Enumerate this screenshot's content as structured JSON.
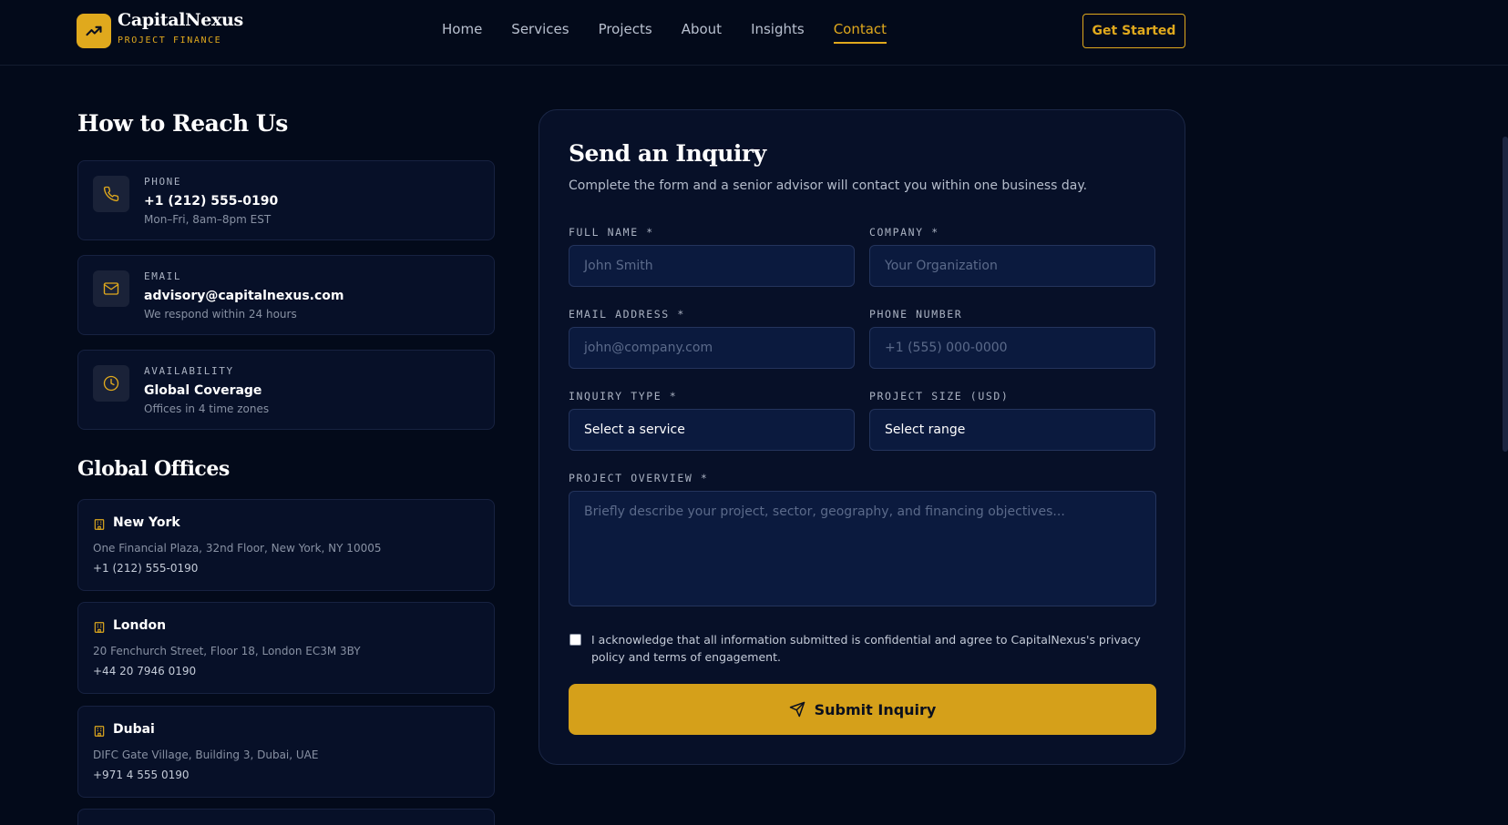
{
  "brand": {
    "name": "CapitalNexus",
    "tagline": "PROJECT FINANCE",
    "accent": "#e0a91d",
    "background": "#030a1a"
  },
  "nav": {
    "items": [
      "Home",
      "Services",
      "Projects",
      "About",
      "Insights",
      "Contact"
    ],
    "active": "Contact",
    "cta": "Get Started"
  },
  "reach": {
    "title": "How to Reach Us",
    "cards": [
      {
        "icon": "phone-icon",
        "label": "PHONE",
        "value": "+1 (212) 555-0190",
        "note": "Mon–Fri, 8am–8pm EST"
      },
      {
        "icon": "mail-icon",
        "label": "EMAIL",
        "value": "advisory@capitalnexus.com",
        "note": "We respond within 24 hours"
      },
      {
        "icon": "clock-icon",
        "label": "AVAILABILITY",
        "value": "Global Coverage",
        "note": "Offices in 4 time zones"
      }
    ]
  },
  "offices": {
    "title": "Global Offices",
    "list": [
      {
        "name": "New York",
        "address": "One Financial Plaza, 32nd Floor, New York, NY 10005",
        "phone": "+1 (212) 555-0190"
      },
      {
        "name": "London",
        "address": "20 Fenchurch Street, Floor 18, London EC3M 3BY",
        "phone": "+44 20 7946 0190"
      },
      {
        "name": "Dubai",
        "address": "DIFC Gate Village, Building 3, Dubai, UAE",
        "phone": "+971 4 555 0190"
      }
    ]
  },
  "form": {
    "title": "Send an Inquiry",
    "subtitle": "Complete the form and a senior advisor will contact you within one business day.",
    "full_name": {
      "label": "FULL NAME *",
      "placeholder": "John Smith"
    },
    "company": {
      "label": "COMPANY *",
      "placeholder": "Your Organization"
    },
    "email": {
      "label": "EMAIL ADDRESS *",
      "placeholder": "john@company.com"
    },
    "phone": {
      "label": "PHONE NUMBER",
      "placeholder": "+1 (555) 000-0000"
    },
    "inquiry_type": {
      "label": "INQUIRY TYPE *",
      "value": "Select a service"
    },
    "project_size": {
      "label": "PROJECT SIZE (USD)",
      "value": "Select range"
    },
    "overview": {
      "label": "PROJECT OVERVIEW *",
      "placeholder": "Briefly describe your project, sector, geography, and financing objectives..."
    },
    "consent": "I acknowledge that all information submitted is confidential and agree to CapitalNexus's privacy policy and terms of engagement.",
    "submit": "Submit Inquiry"
  }
}
